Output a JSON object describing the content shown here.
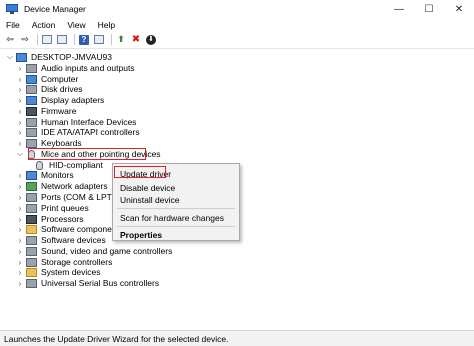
{
  "window": {
    "title": "Device Manager",
    "minimize": "—",
    "maximize": "☐",
    "close": "✕"
  },
  "menu": [
    "File",
    "Action",
    "View",
    "Help"
  ],
  "toolbar": {
    "icons": [
      "back-arrow-icon",
      "forward-arrow-icon",
      "properties-icon",
      "show-hide-icon",
      "help-icon",
      "scan-icon",
      "update-driver-icon",
      "uninstall-icon",
      "download-icon"
    ]
  },
  "tree": {
    "root": "DESKTOP-JMVAU93",
    "items": [
      {
        "label": "Audio inputs and outputs",
        "icon": "speaker-icon"
      },
      {
        "label": "Computer",
        "icon": "computer-icon"
      },
      {
        "label": "Disk drives",
        "icon": "disk-icon"
      },
      {
        "label": "Display adapters",
        "icon": "display-icon"
      },
      {
        "label": "Firmware",
        "icon": "firmware-icon"
      },
      {
        "label": "Human Interface Devices",
        "icon": "hid-icon"
      },
      {
        "label": "IDE ATA/ATAPI controllers",
        "icon": "ide-icon"
      },
      {
        "label": "Keyboards",
        "icon": "keyboard-icon"
      },
      {
        "label": "Mice and other pointing devices",
        "icon": "mouse-icon",
        "expanded": true
      },
      {
        "label": "HID-compliant",
        "icon": "mouse-icon",
        "child": true
      },
      {
        "label": "Monitors",
        "icon": "monitor-icon"
      },
      {
        "label": "Network adapters",
        "icon": "network-icon"
      },
      {
        "label": "Ports (COM & LPT",
        "icon": "port-icon"
      },
      {
        "label": "Print queues",
        "icon": "printer-icon"
      },
      {
        "label": "Processors",
        "icon": "cpu-icon"
      },
      {
        "label": "Software compone",
        "icon": "software-icon"
      },
      {
        "label": "Software devices",
        "icon": "software-device-icon"
      },
      {
        "label": "Sound, video and game controllers",
        "icon": "sound-icon"
      },
      {
        "label": "Storage controllers",
        "icon": "storage-icon"
      },
      {
        "label": "System devices",
        "icon": "system-icon"
      },
      {
        "label": "Universal Serial Bus controllers",
        "icon": "usb-icon"
      }
    ]
  },
  "context_menu": {
    "update": "Update driver",
    "disable": "Disable device",
    "uninstall": "Uninstall device",
    "scan": "Scan for hardware changes",
    "properties": "Properties"
  },
  "status": "Launches the Update Driver Wizard for the selected device.",
  "colors": {
    "highlight": "#d6262c"
  }
}
